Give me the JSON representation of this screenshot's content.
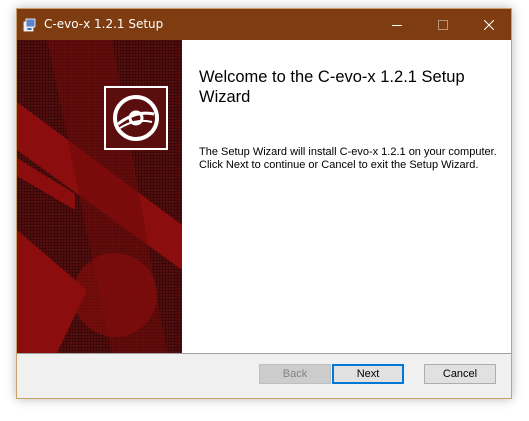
{
  "window": {
    "title": "C-evo-x 1.2.1 Setup",
    "icon": "installer-icon",
    "controls": {
      "minimize": "minimize-icon",
      "maximize": "maximize-icon",
      "close": "close-icon"
    }
  },
  "banner": {
    "logo_icon": "disc-icon"
  },
  "main": {
    "heading": "Welcome to the C-evo-x 1.2.1 Setup Wizard",
    "body": "The Setup Wizard will install C-evo-x 1.2.1 on your computer. Click Next to continue or Cancel to exit the Setup Wizard."
  },
  "buttons": {
    "back": {
      "label": "Back",
      "enabled": false
    },
    "next": {
      "label": "Next",
      "enabled": true,
      "default": true
    },
    "cancel": {
      "label": "Cancel",
      "enabled": true
    }
  },
  "colors": {
    "titlebar": "#7e3c10",
    "banner_dark": "#5a0e0e",
    "banner_red": "#8c0d0d",
    "focus_border": "#0078d7"
  }
}
